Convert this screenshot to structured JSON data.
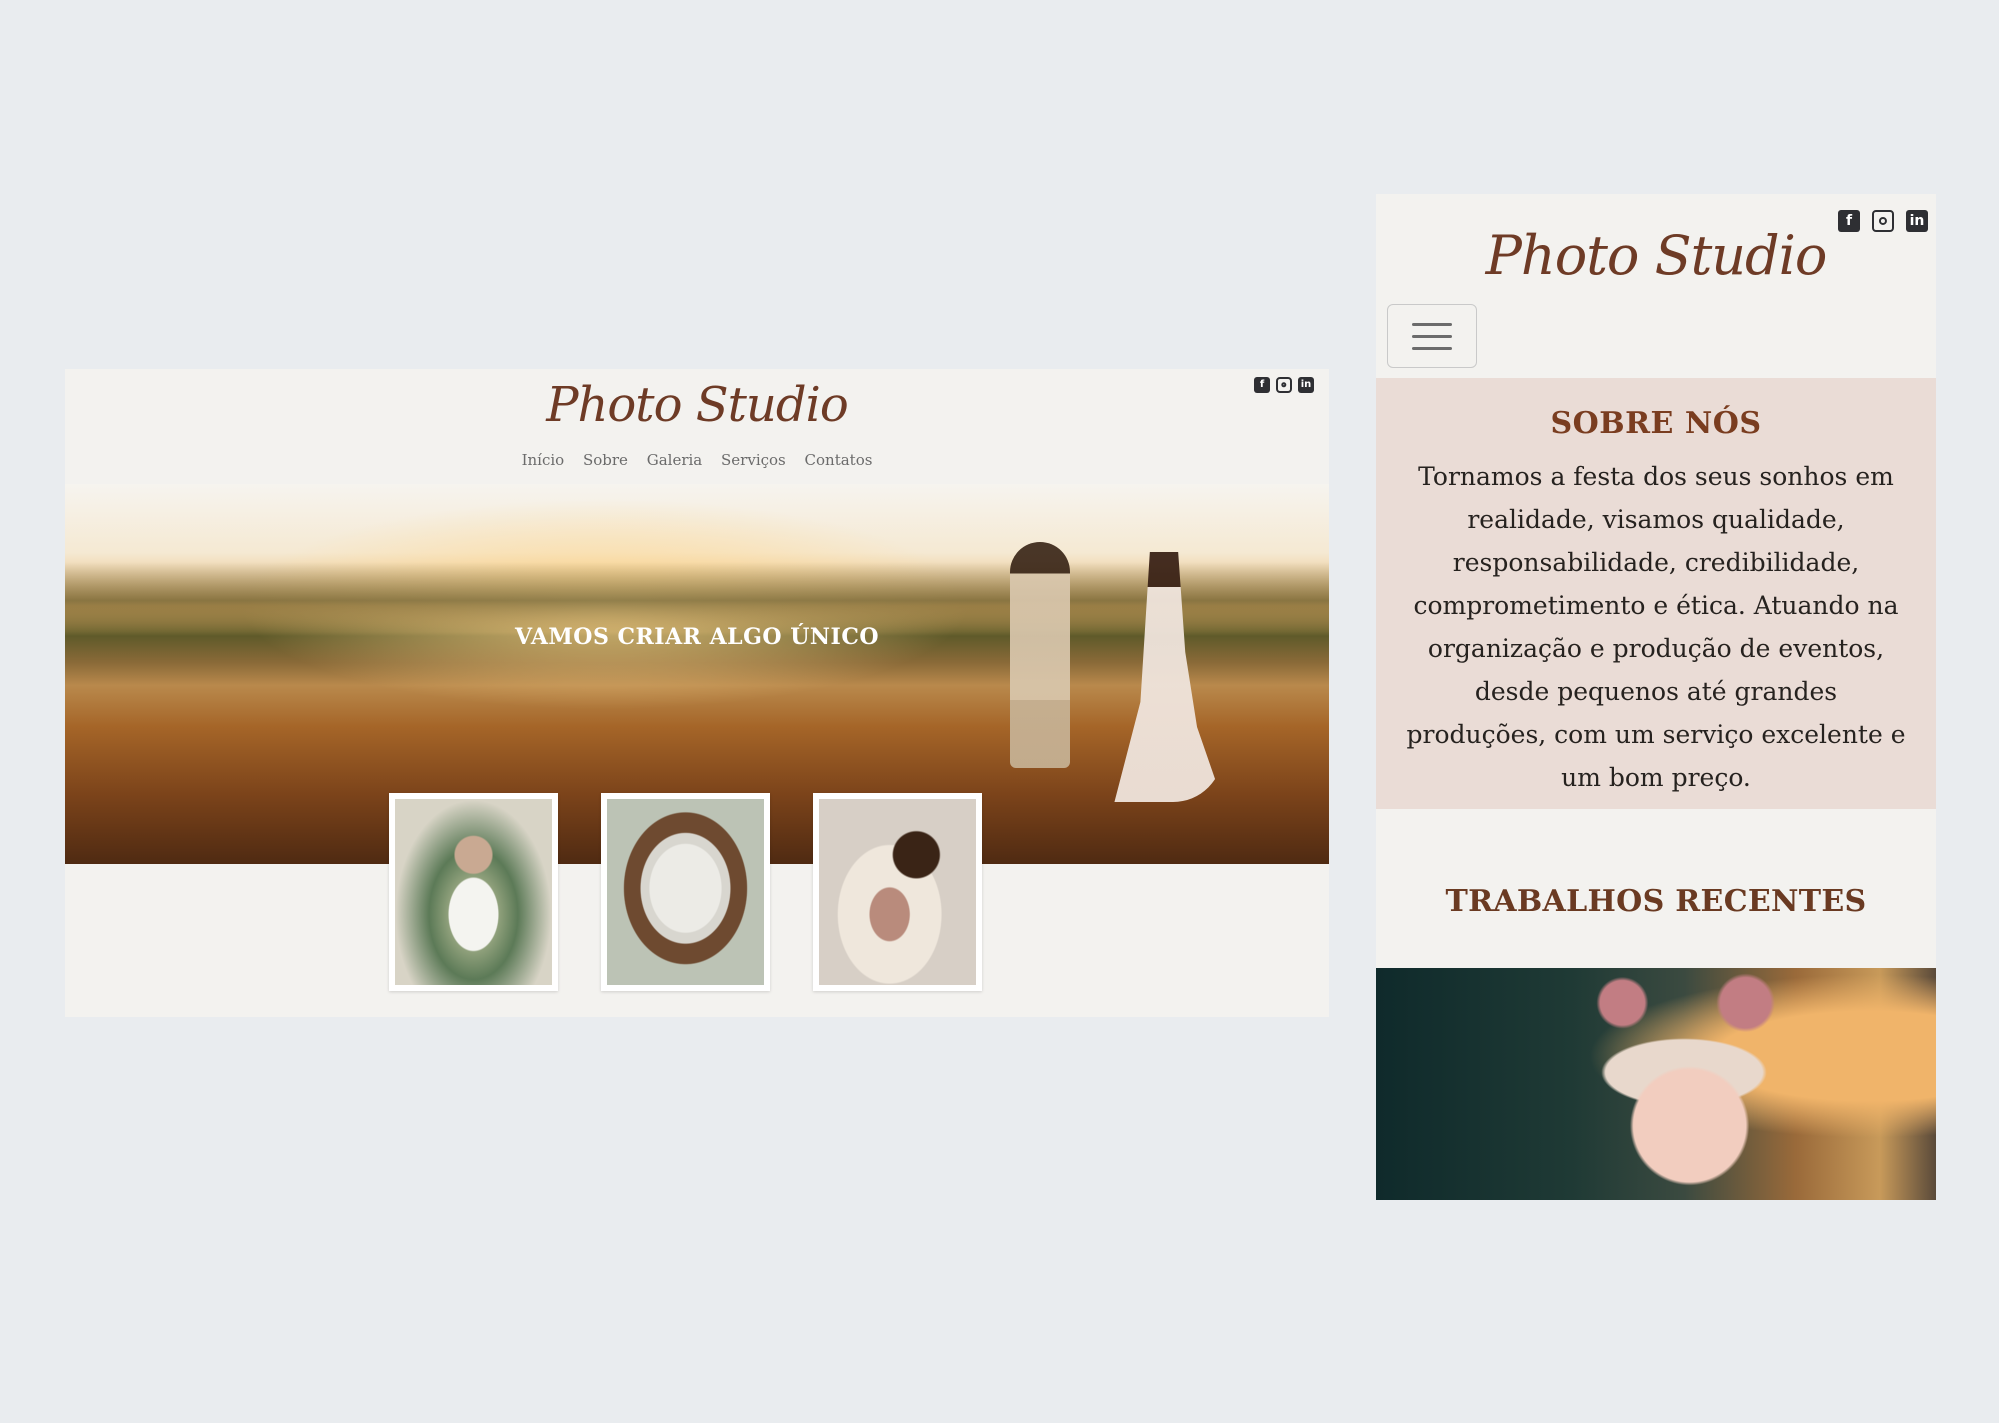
{
  "brand": "Photo Studio",
  "social": {
    "facebook": "f",
    "instagram": "",
    "linkedin": "in"
  },
  "nav": [
    "Início",
    "Sobre",
    "Galeria",
    "Serviços",
    "Contatos"
  ],
  "hero": {
    "tagline": "VAMOS CRIAR ALGO ÚNICO"
  },
  "about": {
    "title": "SOBRE NÓS",
    "text": "Tornamos a festa dos seus sonhos em realidade, visamos qualidade, responsabilidade, credibilidade, comprometimento e ética. Atuando na organização e produção de eventos, desde pequenos até grandes produções, com um serviço excelente e um bom preço."
  },
  "recent": {
    "title": "TRABALHOS RECENTES"
  },
  "colors": {
    "brand": "#6e3b26",
    "about_bg": "#eadcd6",
    "page_bg": "#e9ecef",
    "panel_bg": "#f3f2ef"
  }
}
